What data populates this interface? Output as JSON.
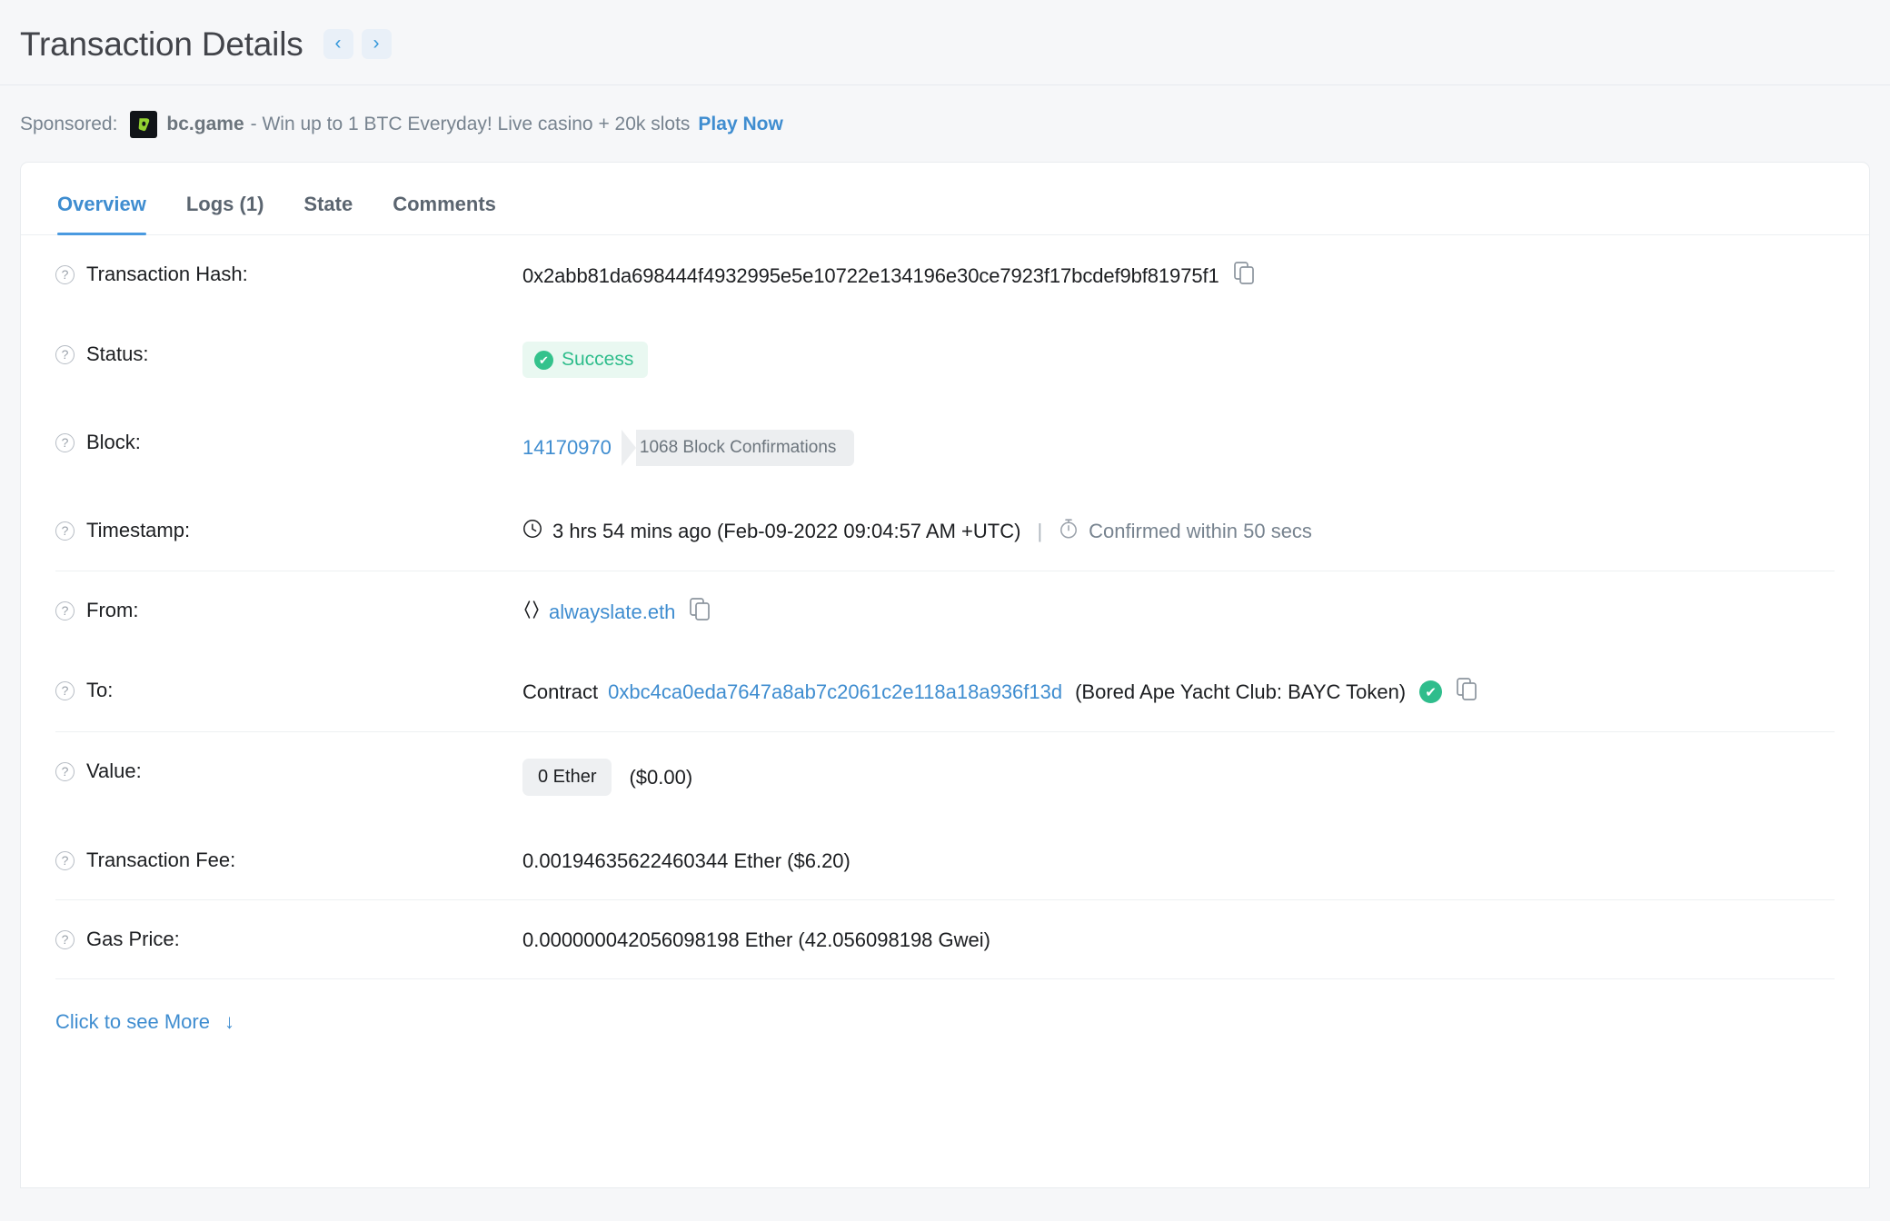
{
  "header": {
    "title": "Transaction Details",
    "prev_label": "‹",
    "next_label": "›"
  },
  "sponsored": {
    "label": "Sponsored:",
    "advertiser": "bc.game",
    "text": "- Win up to 1 BTC Everyday! Live casino + 20k slots",
    "cta": "Play Now"
  },
  "tabs": [
    {
      "label": "Overview",
      "active": true
    },
    {
      "label": "Logs (1)",
      "active": false
    },
    {
      "label": "State",
      "active": false
    },
    {
      "label": "Comments",
      "active": false
    }
  ],
  "details": {
    "transaction_hash": {
      "label": "Transaction Hash:",
      "value": "0x2abb81da698444f4932995e5e10722e134196e30ce7923f17bcdef9bf81975f1"
    },
    "status": {
      "label": "Status:",
      "value": "Success"
    },
    "block": {
      "label": "Block:",
      "number": "14170970",
      "confirmations": "1068 Block Confirmations"
    },
    "timestamp": {
      "label": "Timestamp:",
      "relative": "3 hrs 54 mins ago (Feb-09-2022 09:04:57 AM +UTC)",
      "separator": "|",
      "confirmed": "Confirmed within 50 secs"
    },
    "from": {
      "label": "From:",
      "value": "alwayslate.eth"
    },
    "to": {
      "label": "To:",
      "prefix": "Contract",
      "address": "0xbc4ca0eda7647a8ab7c2061c2e118a18a936f13d",
      "token_name": "(Bored Ape Yacht Club: BAYC Token)"
    },
    "value": {
      "label": "Value:",
      "ether": "0 Ether",
      "usd": "($0.00)"
    },
    "transaction_fee": {
      "label": "Transaction Fee:",
      "value": "0.00194635622460344 Ether ($6.20)"
    },
    "gas_price": {
      "label": "Gas Price:",
      "value": "0.000000042056098198 Ether (42.056098198 Gwei)"
    }
  },
  "footer": {
    "more_label": "Click to see More",
    "more_arrow": "↓"
  },
  "colors": {
    "accent": "#3f8dd0",
    "success": "#2fbd8c",
    "text": "#1c1e21",
    "muted": "#77838f",
    "page_bg": "#f6f7f9"
  },
  "icons": {
    "question": "?",
    "copy": "copy-icon",
    "clock": "clock-icon",
    "stopwatch": "stopwatch-icon",
    "check": "✔",
    "ens": "〈〉"
  }
}
